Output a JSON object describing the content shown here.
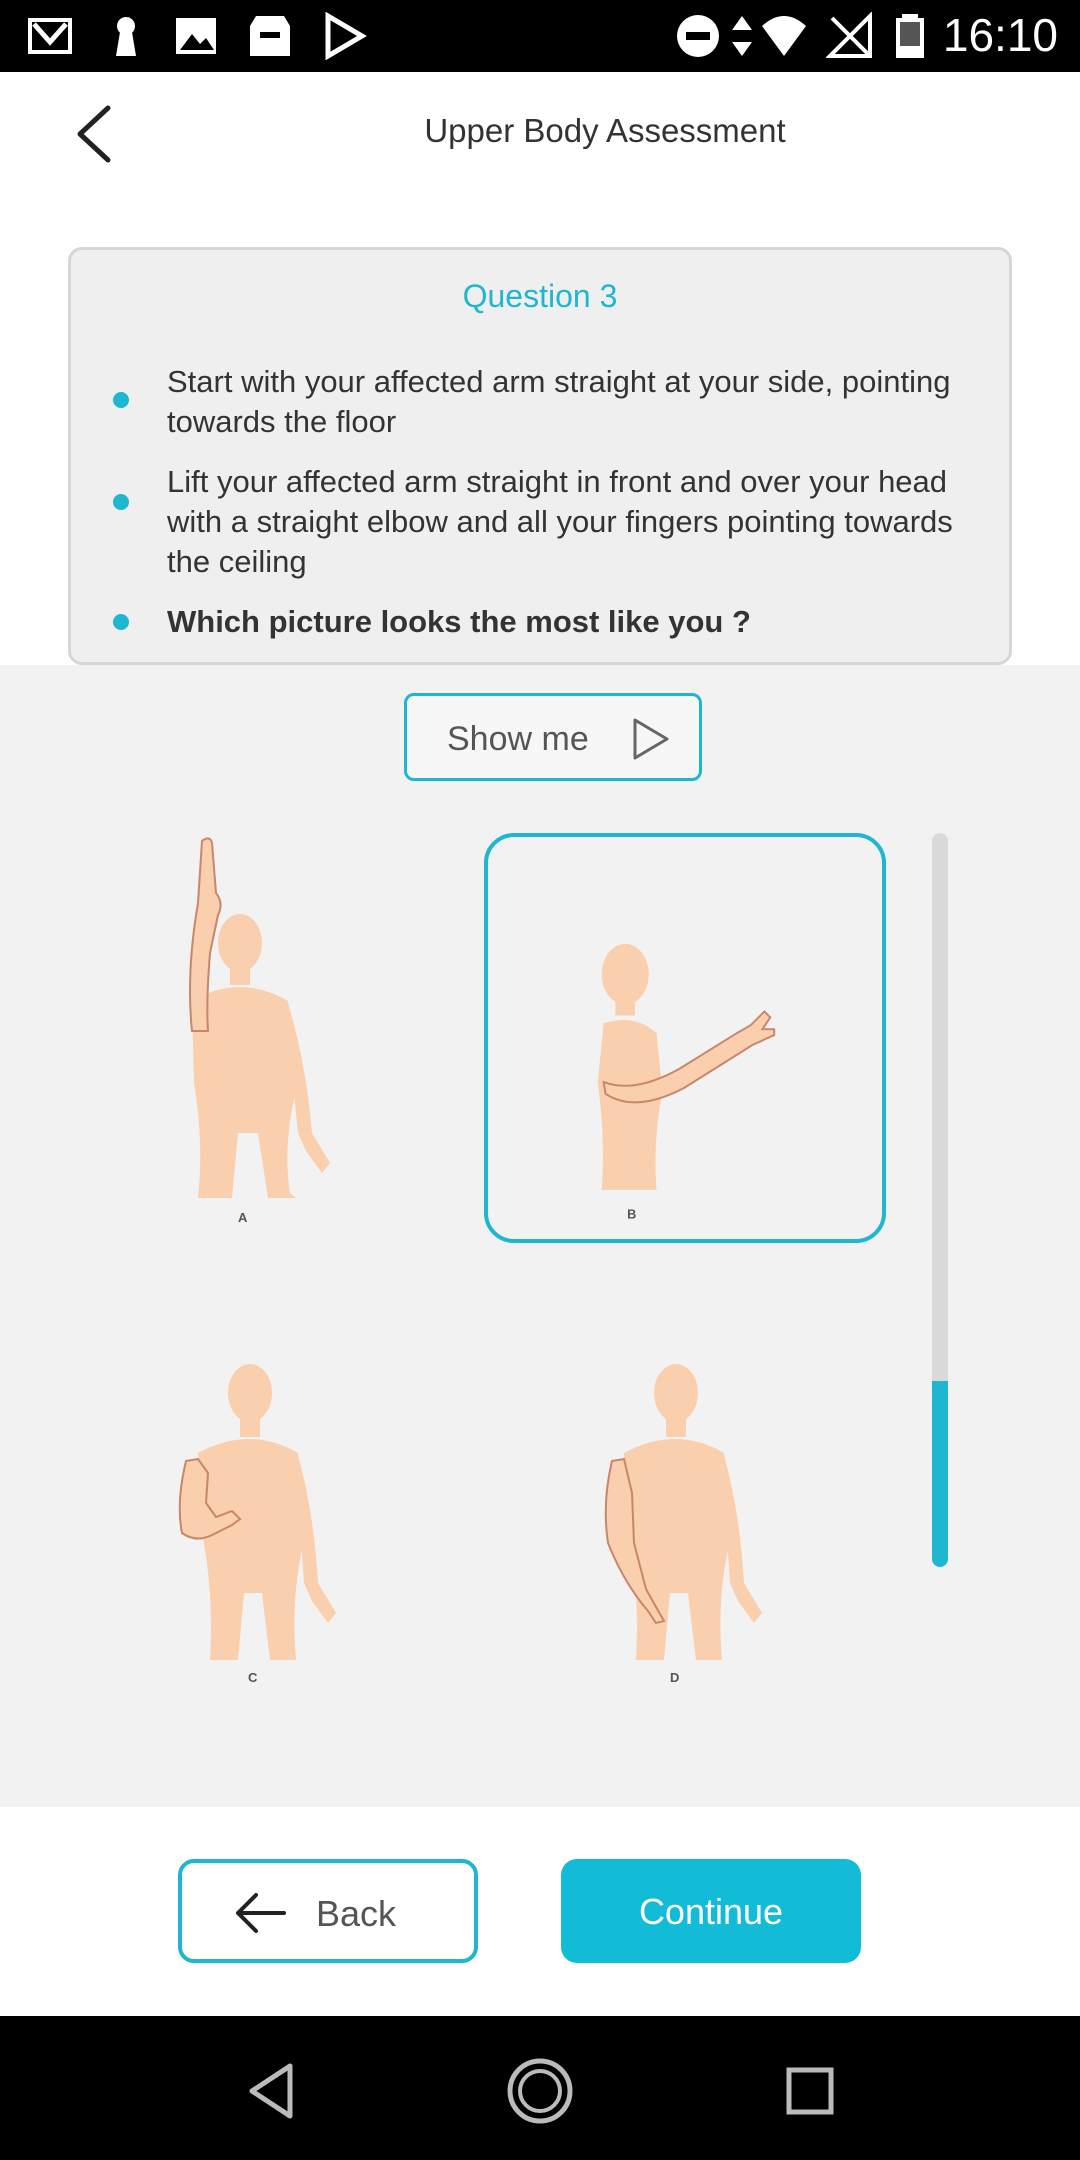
{
  "status_bar": {
    "time": "16:10",
    "icons": [
      "gmail-icon",
      "keyhole-icon",
      "image-icon",
      "store-icon",
      "play-store-icon",
      "do-not-disturb-icon",
      "data-arrows-icon",
      "wifi-icon",
      "no-signal-icon",
      "battery-icon"
    ]
  },
  "header": {
    "title": "Upper Body Assessment",
    "back_icon": "chevron-left-icon"
  },
  "question": {
    "title": "Question 3",
    "bullets": [
      "Start with your affected arm straight at your side, pointing towards the floor",
      "Lift your affected arm straight in front and over your head with a straight elbow and all your fingers pointing towards the ceiling",
      "Which picture looks the most like you ?"
    ]
  },
  "show_me": {
    "label": "Show me",
    "icon": "play-icon"
  },
  "options": [
    {
      "label": "A",
      "selected": false
    },
    {
      "label": "B",
      "selected": true
    },
    {
      "label": "C",
      "selected": false
    },
    {
      "label": "D",
      "selected": false
    }
  ],
  "scroll": {
    "position_fraction": 0.75
  },
  "buttons": {
    "back": "Back",
    "continue": "Continue"
  },
  "colors": {
    "accent": "#1fb7cf",
    "skin": "#f9cfae",
    "skin_outline": "#c8866a"
  },
  "nav": {
    "icons": [
      "nav-back-icon",
      "nav-home-icon",
      "nav-recents-icon"
    ]
  }
}
